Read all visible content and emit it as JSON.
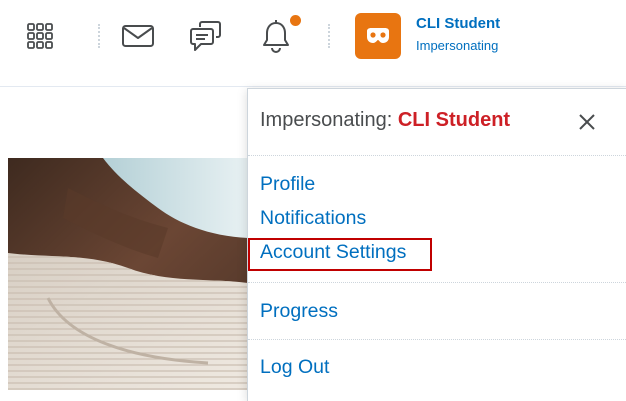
{
  "topbar": {
    "icons": [
      "grid-icon",
      "mail-icon",
      "chat-icon",
      "bell-icon"
    ],
    "notification_badge_color": "#e87511",
    "user": {
      "name": "CLI Student",
      "role": "Impersonating",
      "avatar_icon": "mask-icon",
      "avatar_color": "#e87511"
    }
  },
  "dropdown": {
    "title_prefix": "Impersonating: ",
    "title_name": "CLI Student",
    "close_icon": "close-icon",
    "links": {
      "profile": "Profile",
      "notifications": "Notifications",
      "account_settings": "Account Settings",
      "progress": "Progress",
      "logout": "Log Out"
    }
  },
  "colors": {
    "link": "#006fbf",
    "impersonated_name": "#cd2026",
    "highlight_box": "#c00000",
    "accent": "#e87511"
  }
}
